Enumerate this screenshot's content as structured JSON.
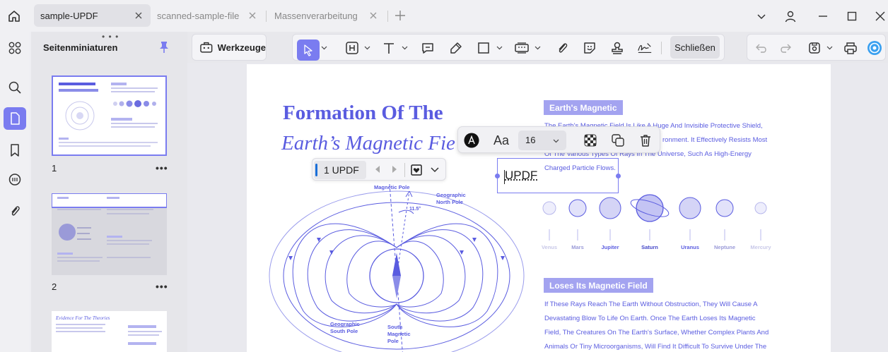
{
  "tabs": [
    {
      "label": "sample-UPDF",
      "active": true
    },
    {
      "label": "scanned-sample-file",
      "active": false
    },
    {
      "label": "Massenverarbeitung",
      "active": false
    }
  ],
  "panel": {
    "drag_dots": "• • •",
    "title": "Seitenminiaturen",
    "more": "•••",
    "thumbs": [
      {
        "page": "1"
      },
      {
        "page": "2"
      }
    ],
    "thumb3_title": "Evidence For The Theories"
  },
  "toolbar": {
    "werkzeuge_label": "Werkzeuge",
    "close_label": "Schließen"
  },
  "floating_toolbar": {
    "font_size": "16",
    "aa_label": "Aa",
    "a_label": "A"
  },
  "page_nav": {
    "label": "1 UPDF"
  },
  "edit_box": {
    "text": "UPDF"
  },
  "document": {
    "title_line1": "Formation Of The",
    "title_line2": "Earth’s Magnetic Fie",
    "section1_badge": "Earth's Magnetic",
    "section1_lines": [
      "The Earth's Magnetic Field Is Like A Huge And Invisible Protective Shield,",
      "ronment. It Effectively Resists Most",
      "Of The Various Types Of Rays In The Universe, Such As High-Energy",
      "Charged Particle Flows."
    ],
    "planets": [
      {
        "name": "Venus",
        "color": "#c8c8e8"
      },
      {
        "name": "Mars",
        "color": "#9a9ad8"
      },
      {
        "name": "Jupiter",
        "color": "#5a5ce0"
      },
      {
        "name": "Saturn",
        "color": "#4648c8"
      },
      {
        "name": "Uranus",
        "color": "#5a5ce0"
      },
      {
        "name": "Neptune",
        "color": "#9a9ad8"
      },
      {
        "name": "Mercury",
        "color": "#c8c8e8"
      }
    ],
    "section2_badge": "Loses Its Magnetic Field",
    "section2_lines": [
      "If These Rays Reach The Earth Without Obstruction, They Will Cause A",
      "Devastating Blow To Life On Earth. Once The Earth Loses Its Magnetic",
      "Field, The Creatures On The Earth's Surface, Whether Complex Plants And",
      "Animals Or Tiny Microorganisms, Will Find It Difficult To Survive Under The"
    ],
    "poles": {
      "magnetic_pole": "Magnetic Pole",
      "geo_north_1": "Geographic",
      "geo_north_2": "North Pole",
      "geo_south_1": "Geographic",
      "geo_south_2": "South Pole",
      "mag_south_1": "South",
      "mag_south_2": "Magnetic",
      "mag_south_3": "Pole",
      "angle": "11.5°"
    }
  }
}
